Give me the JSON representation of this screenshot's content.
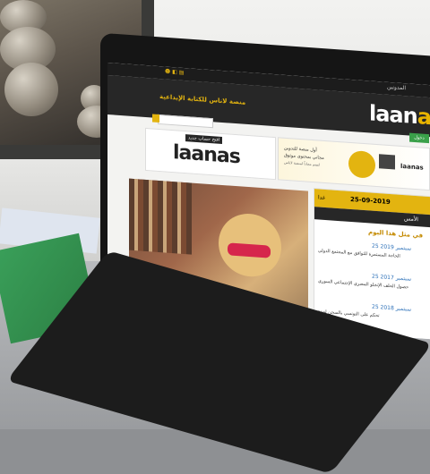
{
  "topbar": {
    "left_icons": "☻ ◧ ▤",
    "right_text": "المدونين"
  },
  "header": {
    "title": "منصة لاناس للكتابة الإبداعية",
    "logo_main": "laan",
    "logo_accent": "a",
    "logo_tail": "s",
    "enter_button": "دخول"
  },
  "banner_left": {
    "button": "افتح حساب جديد",
    "logo": "laanas"
  },
  "banner_right": {
    "line1": "أول منصة للتدوين",
    "line2": "مجاني بمحتوى موثوق",
    "line3": "انضم مجاناً لمنصة لاناس",
    "brand": "laanas"
  },
  "sidebar": {
    "date": "25-09-2019",
    "today_label": "غدا",
    "tab_label": "الأمس",
    "section_title": "في مثل هذا اليوم",
    "entries": [
      {
        "date": "25 سبتمبر 2019",
        "text": "الحاجة المستمرة للتوافق مع المجتمع الدولي"
      },
      {
        "date": "25 سبتمبر 2017",
        "text": "حصول الحلف الإنجلو المصري الإجتماعي السوري"
      },
      {
        "date": "25 سبتمبر 2018",
        "text": "تحكم على التونسي بالسجن لمدة"
      }
    ]
  },
  "colors": {
    "accent": "#e3b410",
    "header": "#272727",
    "topbar": "#1c1c1c"
  }
}
